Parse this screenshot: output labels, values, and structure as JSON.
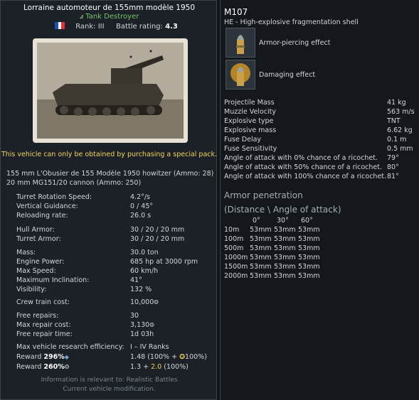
{
  "vehicle": {
    "title": "Lorraine automoteur de 155mm modèle 1950",
    "class": "Tank Destroyer",
    "rank": "Rank: III",
    "battle_rating_label": "Battle rating:",
    "battle_rating": "4.3",
    "notice": "This vehicle can only be obtained by purchasing a special pack."
  },
  "weapons": [
    "155 mm L'Obusier de 155 Modèle 1950 howitzer (Ammo: 28)",
    "20 mm MG151/20 cannon (Ammo: 250)"
  ],
  "stats": {
    "turret_rotation": {
      "label": "Turret Rotation Speed:",
      "value": "4.2°/s"
    },
    "vertical_guidance": {
      "label": "Vertical Guidance:",
      "value": "0 / 45°"
    },
    "reloading_rate": {
      "label": "Reloading rate:",
      "value": "26.0 s"
    },
    "hull_armor": {
      "label": "Hull Armor:",
      "value": "30 / 20 / 20 mm"
    },
    "turret_armor": {
      "label": "Turret Armor:",
      "value": "30 / 20 / 20 mm"
    },
    "mass": {
      "label": "Mass:",
      "value": "30.0 ton"
    },
    "engine_power": {
      "label": "Engine Power:",
      "value": "685 hp at 3000 rpm"
    },
    "max_speed": {
      "label": "Max Speed:",
      "value": "60 km/h"
    },
    "max_inclination": {
      "label": "Maximum Inclination:",
      "value": "41°"
    },
    "visibility": {
      "label": "Visibility:",
      "value": "132 %"
    },
    "crew_train_cost": {
      "label": "Crew train cost:",
      "value": "10,000"
    },
    "free_repairs": {
      "label": "Free repairs:",
      "value": "30"
    },
    "max_repair_cost": {
      "label": "Max repair cost:",
      "value": "3,130"
    },
    "free_repair_time": {
      "label": "Free repair time:",
      "value": "1d 03h"
    },
    "max_research": {
      "label": "Max vehicle research efficiency:",
      "value": "I – IV Ranks"
    },
    "reward_rp": {
      "label_prefix": "Reward ",
      "label_pct": "296%",
      "value_a": "1.48",
      "value_b": "(100% + ",
      "value_c": "100%)"
    },
    "reward_sl": {
      "label_prefix": "Reward ",
      "label_pct": "260%",
      "value_a": "1.3 + ",
      "value_b": "2.0",
      "value_c": " (100%)"
    }
  },
  "footer": {
    "line1": "Information is relevant to: Realistic Battles",
    "line2": "Current vehicle modification."
  },
  "shell": {
    "name": "M107",
    "desc": "HE - High-explosive fragmentation shell",
    "effect1": "Armor-piercing effect",
    "effect2": "Damaging effect",
    "props": [
      {
        "label": "Projectile Mass",
        "value": "41 kg"
      },
      {
        "label": "Muzzle Velocity",
        "value": "563 m/s"
      },
      {
        "label": "Explosive type",
        "value": "TNT"
      },
      {
        "label": "Explosive mass",
        "value": "6.62 kg"
      },
      {
        "label": "Fuse Delay",
        "value": "0.1 m"
      },
      {
        "label": "Fuse Sensitivity",
        "value": "0.5 mm"
      },
      {
        "label": "Angle of attack with 0% chance of a ricochet.",
        "value": "79°"
      },
      {
        "label": "Angle of attack with 50% chance of a ricochet.",
        "value": "80°"
      },
      {
        "label": "Angle of attack with 100% chance of a ricochet.",
        "value": "81°"
      }
    ],
    "penetration": {
      "title": "Armor penetration",
      "subtitle": "(Distance \\ Angle of attack)",
      "angles": [
        "0°",
        "30°",
        "60°"
      ],
      "rows": [
        {
          "dist": "10m",
          "v": [
            "53mm",
            "53mm",
            "53mm"
          ]
        },
        {
          "dist": "100m",
          "v": [
            "53mm",
            "53mm",
            "53mm"
          ]
        },
        {
          "dist": "500m",
          "v": [
            "53mm",
            "53mm",
            "53mm"
          ]
        },
        {
          "dist": "1000m",
          "v": [
            "53mm",
            "53mm",
            "53mm"
          ]
        },
        {
          "dist": "1500m",
          "v": [
            "53mm",
            "53mm",
            "53mm"
          ]
        },
        {
          "dist": "2000m",
          "v": [
            "53mm",
            "53mm",
            "53mm"
          ]
        }
      ]
    }
  },
  "colors": {
    "accent_class": "#76c46a",
    "notice": "#f4d35e",
    "flag": [
      "#1f4fb5",
      "#ffffff",
      "#e0323b"
    ]
  },
  "icons": [
    "tank-destroyer-icon",
    "france-flag-icon",
    "silver-lion-icon",
    "research-point-icon",
    "armor-piercing-shell-icon",
    "damage-shell-icon"
  ]
}
